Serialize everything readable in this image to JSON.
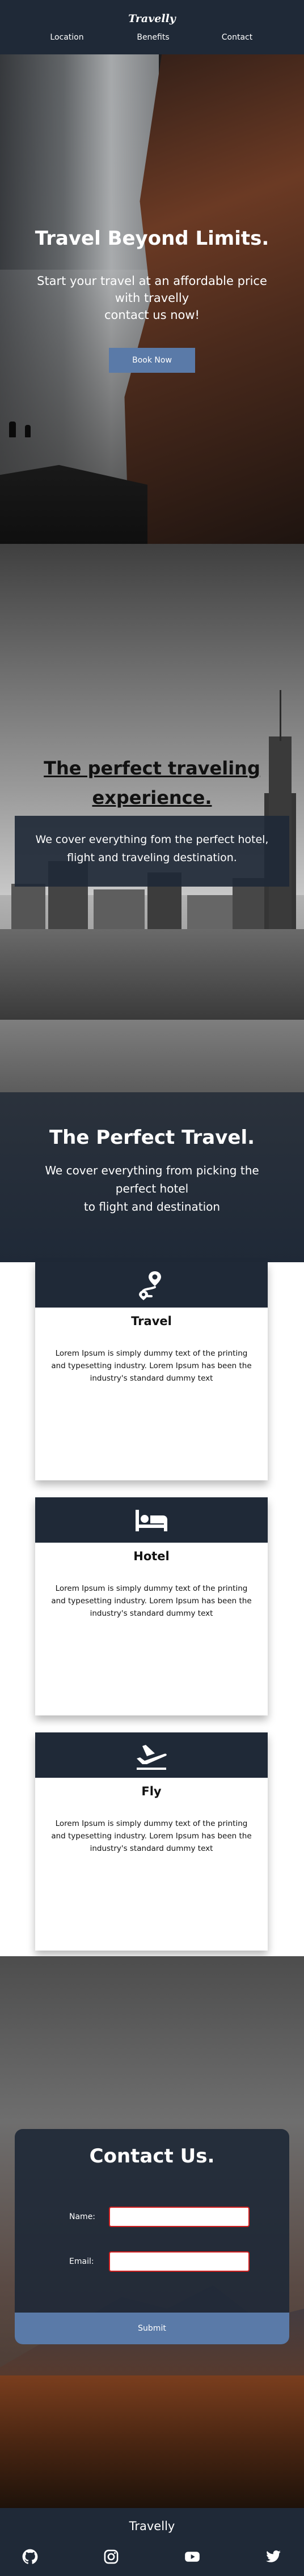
{
  "header": {
    "brand": "Travelly",
    "nav": [
      {
        "label": "Location"
      },
      {
        "label": "Benefits"
      },
      {
        "label": "Contact"
      }
    ]
  },
  "hero": {
    "title": "Travel Beyond Limits.",
    "subtitle_lines": [
      "Start your travel at an affordable price",
      "with travelly",
      "contact us now!"
    ],
    "cta_label": "Book Now"
  },
  "experience": {
    "title_lines": [
      "The perfect traveling",
      "experience."
    ],
    "text_lines": [
      "We cover everything fom the perfect hotel,",
      "flight and traveling destination."
    ]
  },
  "perfect": {
    "title": "The Perfect Travel.",
    "text_lines": [
      "We cover everything from picking the",
      "perfect hotel",
      "to flight and destination"
    ]
  },
  "cards": [
    {
      "icon": "route-pin-icon",
      "title": "Travel",
      "text": "Lorem Ipsum is simply dummy text of the printing and typesetting industry. Lorem Ipsum has been the industry's standard dummy text"
    },
    {
      "icon": "bed-icon",
      "title": "Hotel",
      "text": "Lorem Ipsum is simply dummy text of the printing and typesetting industry. Lorem Ipsum has been the industry's standard dummy text"
    },
    {
      "icon": "airplane-icon",
      "title": "Fly",
      "text": "Lorem Ipsum is simply dummy text of the printing and typesetting industry. Lorem Ipsum has been the industry's standard dummy text"
    }
  ],
  "contact": {
    "title": "Contact Us.",
    "name_label": "Name:",
    "email_label": "Email:",
    "name_value": "",
    "email_value": "",
    "submit_label": "Submit"
  },
  "footer": {
    "brand": "Travelly",
    "social": [
      "github-icon",
      "instagram-icon",
      "youtube-icon",
      "twitter-icon"
    ]
  },
  "colors": {
    "dark": "#1f2937",
    "accent": "#5a7aa8",
    "field_border": "#d21f1f"
  }
}
